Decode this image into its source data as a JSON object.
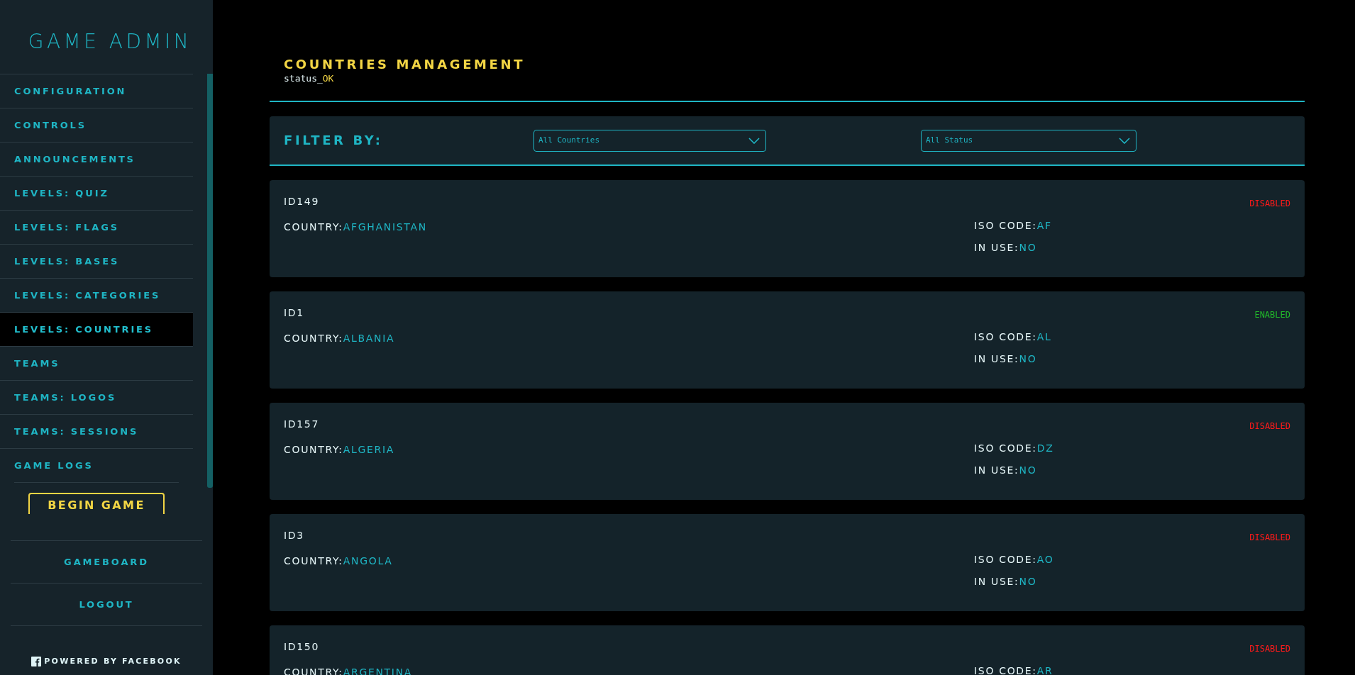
{
  "sidebar": {
    "title": "GAME ADMIN",
    "items": [
      {
        "label": "CONFIGURATION",
        "selected": false
      },
      {
        "label": "CONTROLS",
        "selected": false
      },
      {
        "label": "ANNOUNCEMENTS",
        "selected": false
      },
      {
        "label": "LEVELS: QUIZ",
        "selected": false
      },
      {
        "label": "LEVELS: FLAGS",
        "selected": false
      },
      {
        "label": "LEVELS: BASES",
        "selected": false
      },
      {
        "label": "LEVELS: CATEGORIES",
        "selected": false
      },
      {
        "label": "LEVELS: COUNTRIES",
        "selected": true
      },
      {
        "label": "TEAMS",
        "selected": false
      },
      {
        "label": "TEAMS: LOGOS",
        "selected": false
      },
      {
        "label": "TEAMS: SESSIONS",
        "selected": false
      },
      {
        "label": "GAME LOGS",
        "selected": false
      }
    ],
    "begin_button": "BEGIN GAME",
    "footer_links": [
      "GAMEBOARD",
      "LOGOUT"
    ],
    "powered_by": "POWERED BY FACEBOOK"
  },
  "header": {
    "title": "COUNTRIES MANAGEMENT",
    "status_label": "status_",
    "status_value": "OK"
  },
  "filter": {
    "label": "FILTER BY:",
    "selects": [
      "All Countries",
      "All Status"
    ]
  },
  "countries": [
    {
      "id": "ID149",
      "status": "DISABLED",
      "enabled": false,
      "country_label": "COUNTRY:",
      "country": "AFGHANISTAN",
      "iso_label": "ISO CODE:",
      "iso": "AF",
      "in_use_label": "IN USE:",
      "in_use": "NO"
    },
    {
      "id": "ID1",
      "status": "ENABLED",
      "enabled": true,
      "country_label": "COUNTRY:",
      "country": "ALBANIA",
      "iso_label": "ISO CODE:",
      "iso": "AL",
      "in_use_label": "IN USE:",
      "in_use": "NO"
    },
    {
      "id": "ID157",
      "status": "DISABLED",
      "enabled": false,
      "country_label": "COUNTRY:",
      "country": "ALGERIA",
      "iso_label": "ISO CODE:",
      "iso": "DZ",
      "in_use_label": "IN USE:",
      "in_use": "NO"
    },
    {
      "id": "ID3",
      "status": "DISABLED",
      "enabled": false,
      "country_label": "COUNTRY:",
      "country": "ANGOLA",
      "iso_label": "ISO CODE:",
      "iso": "AO",
      "in_use_label": "IN USE:",
      "in_use": "NO"
    },
    {
      "id": "ID150",
      "status": "DISABLED",
      "enabled": false,
      "country_label": "COUNTRY:",
      "country": "ARGENTINA",
      "iso_label": "ISO CODE:",
      "iso": "AR"
    }
  ]
}
